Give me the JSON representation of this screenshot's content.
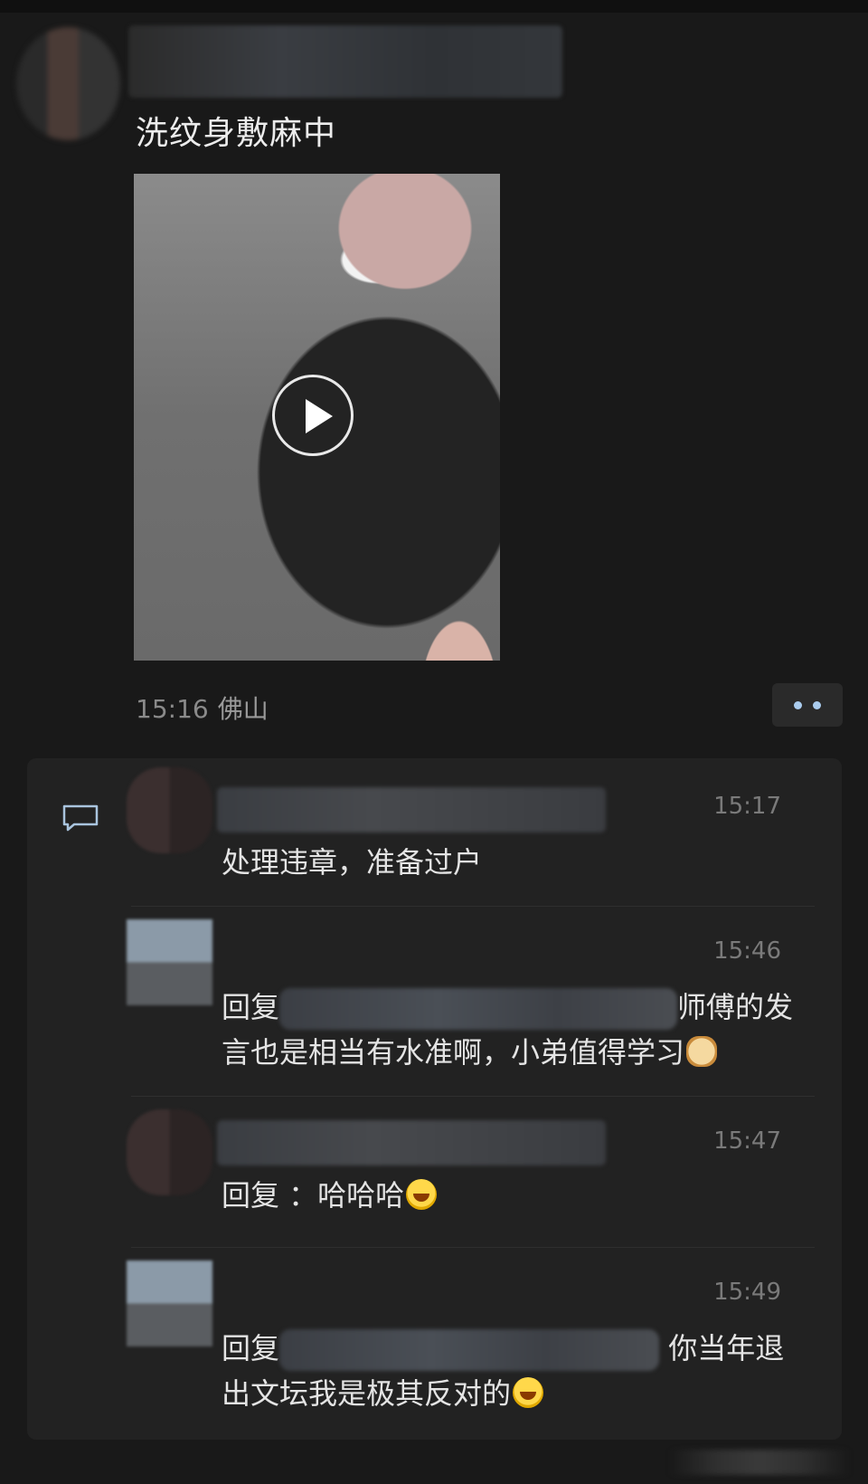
{
  "post": {
    "text": "洗纹身敷麻中",
    "time": "15:16",
    "location": "佛山"
  },
  "icons": {
    "play": "play-icon",
    "more": "more-dots-icon",
    "comment": "comment-bubble-icon",
    "laugh": "laughing-emoji-icon",
    "doge": "doge-emoji-icon"
  },
  "comments": [
    {
      "time": "15:17",
      "text": "处理违章，准备过户"
    },
    {
      "time": "15:46",
      "text_prefix": "回复",
      "text_suffix": "师傅的发",
      "text_line2": "言也是相当有水准啊，小弟值得学习"
    },
    {
      "time": "15:47",
      "text": "回复 ：哈哈哈"
    },
    {
      "time": "15:49",
      "text_prefix": "回复",
      "text_suffix": "你当年退",
      "text_line2": "出文坛我是极其反对的"
    }
  ]
}
